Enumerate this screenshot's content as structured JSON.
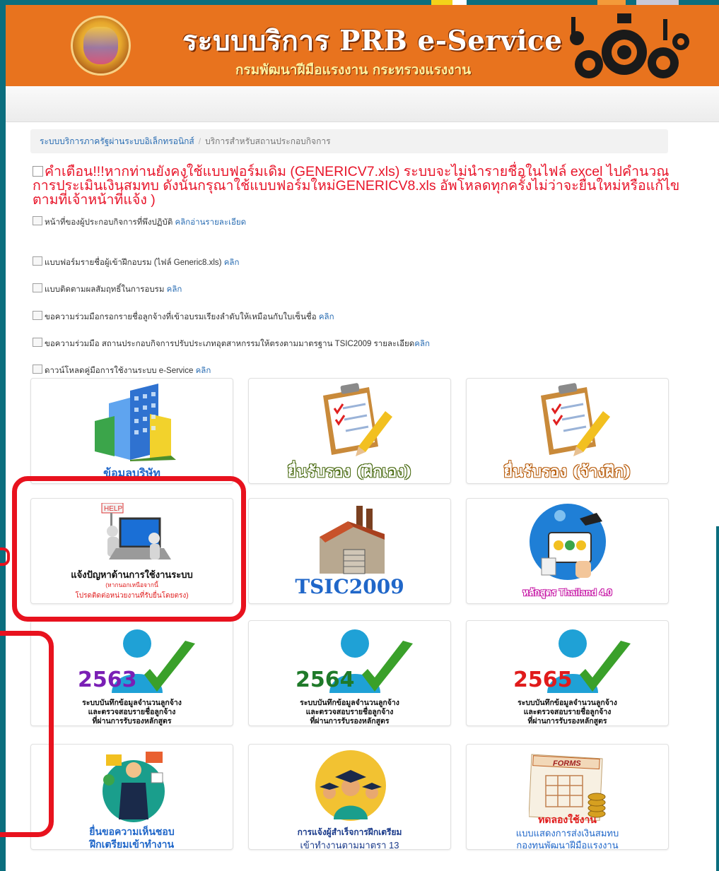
{
  "header": {
    "title": "ระบบบริการ PRB e-Service",
    "subtitle": "กรมพัฒนาฝีมือแรงงาน กระทรวงแรงงาน",
    "logo_icon": "department-emblem-icon",
    "gears_icon": "gears-workers-icon",
    "color": "#e8731e"
  },
  "breadcrumb": {
    "home": "ระบบบริการภาครัฐผ่านระบบอิเล็กทรอนิกส์",
    "separator": "/",
    "current": "บริการสำหรับสถานประกอบกิจการ"
  },
  "warning": {
    "text": "คำเตือน!!!หากท่านยังคงใช้แบบฟอร์มเดิม (GENERICV7.xls) ระบบจะไม่นำรายชื่อในไฟล์ excel ไปคำนวณการประเมินเงินสมทบ ดังนั้นกรุณาใช้แบบฟอร์มใหม่GENERICV8.xls อัพโหลดทุกครั้งไม่ว่าจะยื่นใหม่หรือแก้ไขตามที่เจ้าหน้าที่แจ้ง )",
    "color": "#e8152a"
  },
  "links": [
    {
      "text": "หน้าที่ของผู้ประกอบกิจการที่พึงปฏิบัติ",
      "link": "คลิกอ่านรายละเอียด"
    },
    {
      "text": "แบบฟอร์มรายชื่อผู้เข้าฝึกอบรม (ไฟล์ Generic8.xls)",
      "link": "คลิก"
    },
    {
      "text": "แบบติดตามผลสัมฤทธิ์ในการอบรม",
      "link": "คลิก"
    },
    {
      "text": "ขอความร่วมมือกรอกรายชื่อลูกจ้างที่เข้าอบรมเรียงลำดับให้เหมือนกับใบเซ็นชื่อ",
      "link": "คลิก"
    },
    {
      "text": "ขอความร่วมมือ สถานประกอบกิจการปรับประเภทอุตสาหกรรมให้ตรงตามมาตรฐาน TSIC2009 รายละเอียด",
      "link": "คลิก"
    },
    {
      "text": "ดาวน์โหลดคู่มือการใช้งานระบบ e-Service",
      "link": "คลิก"
    }
  ],
  "tiles": {
    "company": {
      "label": "ข้อมูลบริษัท",
      "icon": "office-building-icon"
    },
    "certify_self": {
      "label": "ยื่นรับรอง (ฝึกเอง)",
      "icon": "clipboard-pencil-icon"
    },
    "certify_outsource": {
      "label": "ยื่นรับรอง (จ้างฝึก)",
      "icon": "clipboard-pencil-icon"
    },
    "help": {
      "label": "แจ้งปัญหาด้านการใช้งานระบบ",
      "note1": "(หากนอกเหนือจากนี้",
      "note2": "โปรดติดต่อหน่วยงานที่รับยื่นโดยตรง)",
      "sign": "HELP",
      "icon": "help-laptop-icon"
    },
    "tsic": {
      "label": "TSIC2009",
      "icon": "factory-icon"
    },
    "thailand40": {
      "label": "หลักสูตร Thailand 4.0",
      "icon": "online-learning-icon"
    },
    "y2563": {
      "year": "2563",
      "line1": "ระบบบันทึกข้อมูลจำนวนลูกจ้าง",
      "line2": "และตรวจสอบรายชื่อลูกจ้าง",
      "line3": "ที่ผ่านการรับรองหลักสูตร",
      "icon": "person-checkmark-icon",
      "year_color": "#7a1fb5"
    },
    "y2564": {
      "year": "2564",
      "line1": "ระบบบันทึกข้อมูลจำนวนลูกจ้าง",
      "line2": "และตรวจสอบรายชื่อลูกจ้าง",
      "line3": "ที่ผ่านการรับรองหลักสูตร",
      "icon": "person-checkmark-icon",
      "year_color": "#1f7a2a"
    },
    "y2565": {
      "year": "2565",
      "line1": "ระบบบันทึกข้อมูลจำนวนลูกจ้าง",
      "line2": "และตรวจสอบรายชื่อลูกจ้าง",
      "line3": "ที่ผ่านการรับรองหลักสูตร",
      "icon": "person-checkmark-icon",
      "year_color": "#e01b1b"
    },
    "opinion": {
      "line1": "ยื่นขอความเห็นชอบ",
      "line2": "ฝึกเตรียมเข้าทำงาน",
      "icon": "businessman-icon"
    },
    "graduate": {
      "line1": "การแจ้งผู้สำเร็จการฝึกเตรียม",
      "line2": "เข้าทำงานตามมาตรา 13",
      "icon": "graduates-icon"
    },
    "forms": {
      "line1": "ทดลองใช้งาน",
      "line2": "แบบแสดงการส่งเงินสมทบ",
      "line3": "กองทุนพัฒนาฝีมือแรงงาน",
      "sign": "FORMS",
      "icon": "forms-coins-icon"
    }
  }
}
